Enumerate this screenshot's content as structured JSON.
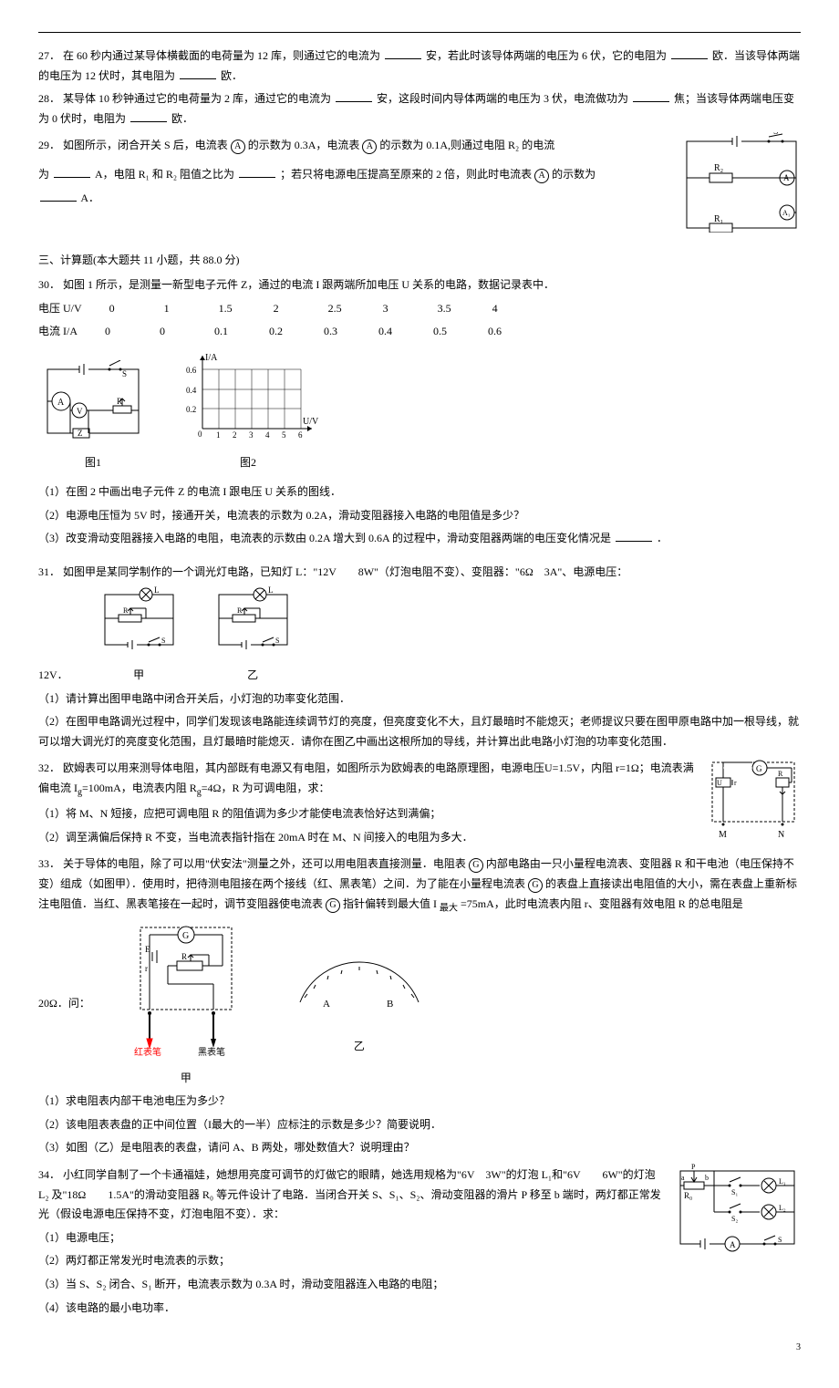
{
  "q27": {
    "num": "27．",
    "text_a": "在 60 秒内通过某导体横截面的电荷量为 12 库，则通过它的电流为",
    "text_b": "安，若此时该导体两端的电压为 6 伏，它的电阻为",
    "text_c": "欧．当该导体两端的电压为 12 伏时，其电阻为",
    "text_d": "欧．"
  },
  "q28": {
    "num": "28．",
    "text_a": "某导体 10 秒钟通过它的电荷量为 2 库，通过它的电流为",
    "text_b": "安，这段时间内导体两端的电压为 3 伏，电流做功为",
    "text_c": "焦；当该导体两端电压变为 0 伏时，电阻为",
    "text_d": "欧．"
  },
  "q29": {
    "num": "29．",
    "text_a": "如图所示，闭合开关 S 后，电流表",
    "a_label": "A",
    "text_b": "的示数为 0.3A，电流表",
    "a1_label": "A",
    "text_c": "的示数为 0.1A,则通过电阻 R₂ 的电流",
    "text_d": "为",
    "text_e": "A，电阻 R₁ 和 R₂ 阻值之比为",
    "text_f": "；若只将电源电压提高至原来的 2 倍，则此时电流表",
    "text_g": "的示数为",
    "text_h": "A．",
    "r1": "R₁",
    "r2": "R₂",
    "s": "S"
  },
  "section3": "三、计算题(本大题共 11 小题，共 88.0 分)",
  "q30": {
    "num": "30．",
    "text": "如图 1 所示，是测量一新型电子元件 Z，通过的电流 I 跟两端所加电压 U 关系的电路，数据记录表中．",
    "row1_label": "电压 U/V",
    "row1_values": [
      "0",
      "1",
      "1.5",
      "2",
      "2.5",
      "3",
      "3.5",
      "4"
    ],
    "row2_label": "电流 I/A",
    "row2_values": [
      "0",
      "0",
      "0.1",
      "0.2",
      "0.3",
      "0.4",
      "0.5",
      "0.6"
    ],
    "ylabel": "I/A",
    "xlabel": "U/V",
    "yticks": [
      "0.6",
      "0.4",
      "0.2",
      "0"
    ],
    "xticks": [
      "1",
      "2",
      "3",
      "4",
      "5",
      "6"
    ],
    "fig1": "图1",
    "fig2": "图2",
    "p1": "（1）在图 2 中画出电子元件 Z 的电流 I 跟电压 U 关系的图线．",
    "p2": "（2）电源电压恒为 5V 时，接通开关，电流表的示数为 0.2A，滑动变阻器接入电路的电阻值是多少？",
    "p3_a": "（3）改变滑动变阻器接入电路的电阻，电流表的示数由 0.2A 增大到 0.6A 的过程中，滑动变阻器两端的电压变化情况是",
    "p3_b": "．"
  },
  "q31": {
    "num": "31．",
    "text": "如图甲是某同学制作的一个调光灯电路，已知灯 L：\"12V　　8W\"（灯泡电阻不变）、变阻器：\"6Ω　3A\"、电源电压：",
    "v12": "12V．",
    "jia": "甲",
    "yi": "乙",
    "p1": "（1）请计算出图甲电路中闭合开关后，小灯泡的功率变化范围．",
    "p2": "（2）在图甲电路调光过程中，同学们发现该电路能连续调节灯的亮度，但亮度变化不大，且灯最暗时不能熄灭；老师提议只要在图甲原电路中加一根导线，就可以增大调光灯的亮度变化范围，且灯最暗时能熄灭．请你在图乙中画出这根所加的导线，并计算出此电路小灯泡的功率变化范围．"
  },
  "q32": {
    "num": "32．",
    "text_a": "欧姆表可以用来测导体电阻，其内部既有电源又有电阻，如图所示为欧姆表的电路原理图，电源电压U=1.5V，内阻 r=1Ω；电流表满偏电流 I",
    "sub_g": "g",
    "text_b": "=100mA，电流表内阻 R",
    "text_c": "=4Ω，R 为可调电阻，求：",
    "p1": "（1）将 M、N 短接，应把可调电阻 R 的阻值调为多少才能使电流表恰好达到满偏；",
    "p2": "（2）调至满偏后保持 R 不变，当电流表指针指在 20mA 时在 M、N 间接入的电阻为多大．",
    "u_label": "U",
    "r_label": "r",
    "g_label": "G",
    "R_label": "R",
    "m": "M",
    "n": "N"
  },
  "q33": {
    "num": "33．",
    "text_a": "关于导体的电阻，除了可以用\"伏安法\"测量之外，还可以用电阻表直接测量．电阻表",
    "g": "G",
    "text_b": "内部电路由一只小量程电流表、变阻器 R 和干电池（电压保持不变）组成（如图甲）．使用时，把待测电阻接在两个接线（红、黑表笔）之间．为了能在小量程电流表",
    "text_c": "的表盘上直接读出电阻值的大小，需在表盘上重新标注电阻值．当红、黑表笔接在一起时，调节变阻器使电流表",
    "text_d": "指针偏转到最大值 I",
    "sub_max": "最大",
    "text_e": "=75mA，此时电流表内阻 r、变阻器有效电阻 R 的总电阻是",
    "val": "20Ω．问：",
    "e_label": "E",
    "r2_label": "r",
    "R2_label": "R",
    "red": "红表笔",
    "black": "黑表笔",
    "jia": "甲",
    "yi": "乙",
    "a": "A",
    "b": "B",
    "p1": "（1）求电阻表内部干电池电压为多少？",
    "p2": "（2）该电阻表表盘的正中间位置（I最大的一半）应标注的示数是多少？简要说明．",
    "p3": "（3）如图（乙）是电阻表的表盘，请问 A、B 两处，哪处数值大？说明理由？"
  },
  "q34": {
    "num": "34．",
    "text_a": "小红同学自制了一个卡通福娃，她想用亮度可调节的灯做它的眼睛，她选用规格为\"6V　3W\"的灯泡 L₁和\"6V　　6W\"的灯泡 L₂ 及\"18Ω　　1.5A\"的滑动变阻器 R₀ 等元件设计了电路．当闭合开关 S、S₁、S₂、滑动变阻器的滑片 P 移至 b 端时，两灯都正常发光（假设电源电压保持不变，灯泡电阻不变）．求：",
    "p1": "（1）电源电压；",
    "p2": "（2）两灯都正常发光时电流表的示数；",
    "p3": "（3）当 S、S₂ 闭合、S₁ 断开，电流表示数为 0.3A 时，滑动变阻器连入电路的电阻；",
    "p4": "（4）该电路的最小电功率．",
    "r0": "R₀",
    "l1": "L₁",
    "l2": "L₂",
    "s1": "S₁",
    "s2": "S₂",
    "s": "S",
    "a": "A",
    "ab": {
      "a": "a",
      "b": "b"
    },
    "p": "P"
  },
  "page_num": "3"
}
